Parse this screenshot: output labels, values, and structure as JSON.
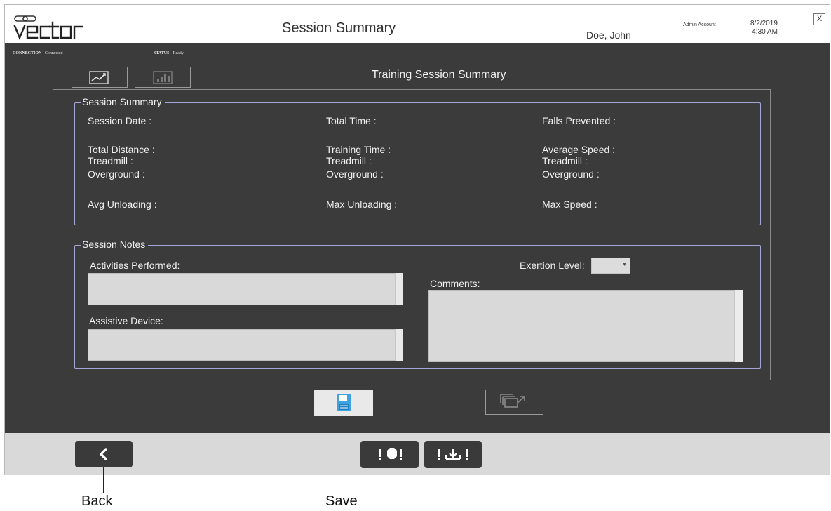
{
  "header": {
    "logo_text": "vector",
    "title": "Session Summary",
    "user_name": "Doe, John",
    "account": "Admin Account",
    "date": "8/2/2019",
    "time": "4:30 AM",
    "close_label": "X"
  },
  "status_bar": {
    "connection_label": "CONNECTION",
    "connection_value": "Connected",
    "status_label": "STATUS:",
    "status_value": "Ready"
  },
  "view_toggle": {
    "items": [
      {
        "name": "line-chart-view",
        "icon": "line-chart-icon"
      },
      {
        "name": "bar-chart-view",
        "icon": "bar-chart-icon"
      }
    ]
  },
  "main": {
    "subtitle": "Training Session Summary"
  },
  "session_summary": {
    "legend": "Session Summary",
    "session_date": "Session Date :",
    "total_time": "Total Time :",
    "falls_prevented": "Falls Prevented :",
    "total_distance": "Total Distance :",
    "training_time": "Training Time :",
    "average_speed": "Average Speed :",
    "treadmill": "Treadmill :",
    "overground": "Overground :",
    "avg_unloading": "Avg Unloading :",
    "max_unloading": "Max Unloading :",
    "max_speed": "Max Speed :"
  },
  "session_notes": {
    "legend": "Session Notes",
    "activities_label": "Activities Performed:",
    "activities_value": "",
    "assistive_label": "Assistive Device:",
    "assistive_value": "",
    "exertion_label": "Exertion Level:",
    "exertion_value": "",
    "comments_label": "Comments:",
    "comments_value": ""
  },
  "actions": {
    "save_icon": "floppy-disk-icon",
    "export_icon": "export-icon"
  },
  "footer": {
    "back_icon": "chevron-left-icon",
    "stop_icon": "emergency-stop-icon",
    "unload_icon": "unload-icon"
  },
  "annotations": {
    "back_label": "Back",
    "save_label": "Save"
  },
  "colors": {
    "background_dark": "#3b3b3b",
    "groupbox_border": "#a4a6d8",
    "save_icon": "#3fa3e0",
    "footer_bg": "#d9d9d9"
  }
}
